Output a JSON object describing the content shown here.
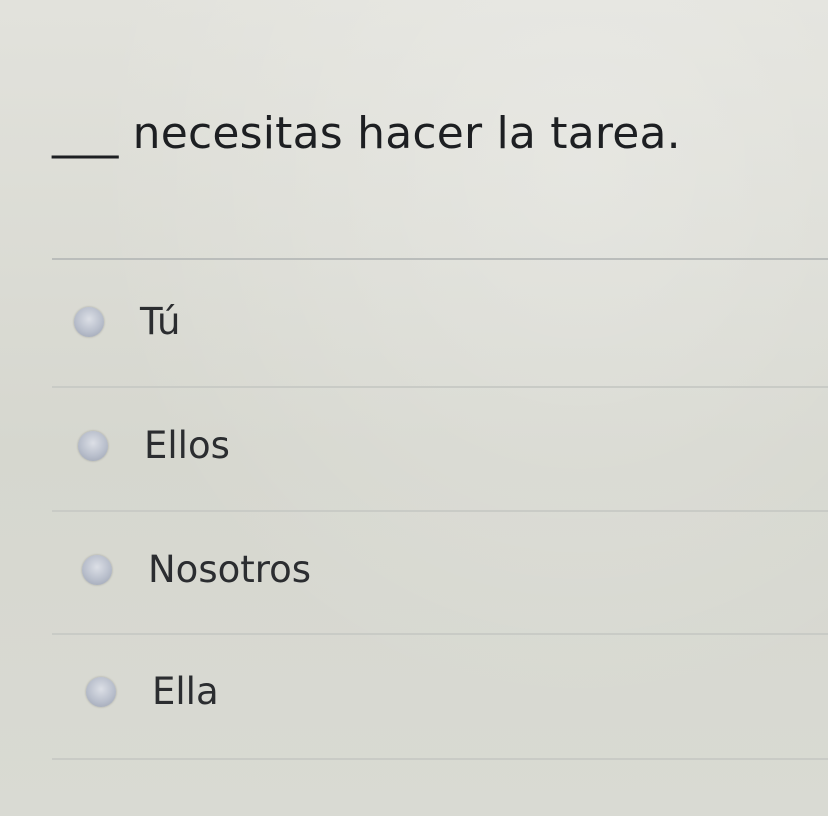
{
  "question": {
    "blank": "___",
    "text": "necesitas hacer la tarea."
  },
  "options": [
    {
      "label": "Tú"
    },
    {
      "label": "Ellos"
    },
    {
      "label": "Nosotros"
    },
    {
      "label": "Ella"
    }
  ]
}
